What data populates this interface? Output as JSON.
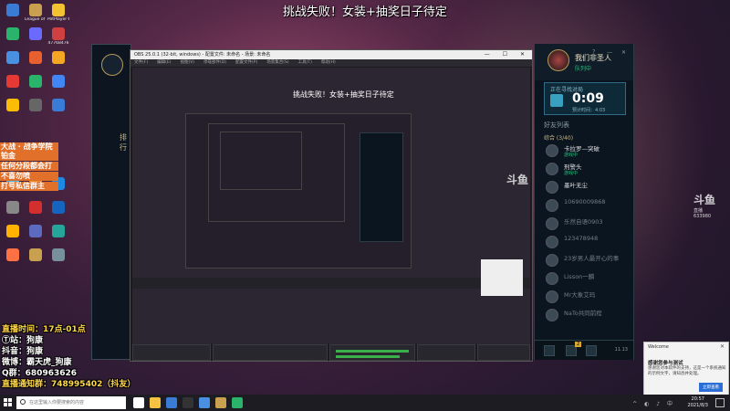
{
  "stream_title": "挑战失败！女装+抽奖日子待定",
  "desktop_icons": [
    {
      "label": "",
      "color": "#3a7bd5"
    },
    {
      "label": "League of Legends",
      "color": "#c8a050"
    },
    {
      "label": "PotPlayer 64 bit",
      "color": "#f2c230"
    },
    {
      "label": "",
      "color": "#2ab36a"
    },
    {
      "label": "",
      "color": "#6a6aff"
    },
    {
      "label": "47768476",
      "color": "#d04040"
    },
    {
      "label": "",
      "color": "#4a90e2"
    },
    {
      "label": "",
      "color": "#e86030"
    },
    {
      "label": "",
      "color": "#f5a623"
    },
    {
      "label": "",
      "color": "#e53935"
    },
    {
      "label": "",
      "color": "#2ab36a"
    },
    {
      "label": "",
      "color": "#4285f4"
    },
    {
      "label": "",
      "color": "#fbbc05"
    },
    {
      "label": "",
      "color": "#666"
    },
    {
      "label": "",
      "color": "#3a7bd5"
    },
    {
      "label": "",
      "color": "#4ab0e8"
    },
    {
      "label": "",
      "color": "#f08a24"
    },
    {
      "label": "",
      "color": "#1e88e5"
    },
    {
      "label": "",
      "color": "#888"
    },
    {
      "label": "",
      "color": "#d32f2f"
    },
    {
      "label": "",
      "color": "#1565c0"
    },
    {
      "label": "",
      "color": "#ffb300"
    },
    {
      "label": "",
      "color": "#5c6bc0"
    },
    {
      "label": "",
      "color": "#26a69a"
    },
    {
      "label": "",
      "color": "#ff7043"
    },
    {
      "label": "",
      "color": "#c8a050"
    },
    {
      "label": "",
      "color": "#78909c"
    }
  ],
  "overlay_notice": [
    "大战 · 战争学院铂金",
    "任何分段都会打",
    "不喜勿喷",
    "打号私信群主"
  ],
  "overlay_info": [
    {
      "text": "直播时间：17点-01点",
      "accent": true
    },
    {
      "text": "Ⓣ站：狗康",
      "accent": false
    },
    {
      "text": "抖音：狗康",
      "accent": false
    },
    {
      "text": "微博：霸天虎_狗康",
      "accent": false
    },
    {
      "text": "Q群：680963626",
      "accent": false
    },
    {
      "text": "直播通知群：748995402（抖友）",
      "accent": true
    }
  ],
  "obs": {
    "title": "OBS 25.0.1 (32-bit, windows) - 配置文件: 未命名 - 场景: 未命名",
    "menu": [
      "文件(F)",
      "编辑(E)",
      "视图(V)",
      "停靠部件(D)",
      "配置文件(P)",
      "场景集合(S)",
      "工具(T)",
      "帮助(H)"
    ],
    "window_controls": "— ☐ ✕",
    "preview_caption": "挑战失败！女装+抽奖日子待定"
  },
  "lol_client": {
    "nav_label": "排行"
  },
  "social": {
    "player_name": "我们非圣人",
    "player_status": "队列中",
    "window_controls": "？ — ✕",
    "queue_label": "正在寻找对局",
    "queue_time": "0:09",
    "queue_estimate": "预计时间：4:03",
    "section_label": "好友列表",
    "group_label": "综合 (3/40)",
    "friends": [
      {
        "name": "卡拉罗—突破",
        "status": "游戏中",
        "online": true
      },
      {
        "name": "刑警头",
        "status": "游戏中",
        "online": true
      },
      {
        "name": "墨叶无尘",
        "status": "",
        "online": true
      },
      {
        "name": "10690009868",
        "status": "",
        "online": false
      },
      {
        "name": "乐然自语0903",
        "status": "",
        "online": false
      },
      {
        "name": "123478948",
        "status": "",
        "online": false
      },
      {
        "name": "23岁男人最开心的事",
        "status": "",
        "online": false
      },
      {
        "name": "Lisson一麟",
        "status": "",
        "online": false
      },
      {
        "name": "Mr大象艾玛",
        "status": "",
        "online": false
      },
      {
        "name": "NaTo共同前程",
        "status": "",
        "online": false
      }
    ],
    "footer_badge": "2",
    "version": "11.13"
  },
  "watermark": {
    "name": "斗鱼",
    "sub": "直播",
    "id": "633980"
  },
  "notification": {
    "app": "Welcome",
    "title": "感谢您参与测试",
    "body": "感谢您对本软件的支持，这是一个系统通知的示例文字，请知悉并处理。",
    "button": "立即查看",
    "close": "✕"
  },
  "taskbar": {
    "search_placeholder": "在这里输入你要搜索的内容",
    "time": "20:57",
    "date": "2021/8/3",
    "apps": [
      {
        "color": "#ffffff"
      },
      {
        "color": "#f5c242"
      },
      {
        "color": "#3a7bd5"
      },
      {
        "color": "#333333"
      },
      {
        "color": "#4a90e2"
      },
      {
        "color": "#c8a050"
      },
      {
        "color": "#2ab36a"
      }
    ]
  },
  "colors": {
    "accent_green": "#22c07a",
    "gold": "#c8b88a",
    "overlay_orange": "#e0702a",
    "overlay_yellow": "#ffd84a"
  }
}
